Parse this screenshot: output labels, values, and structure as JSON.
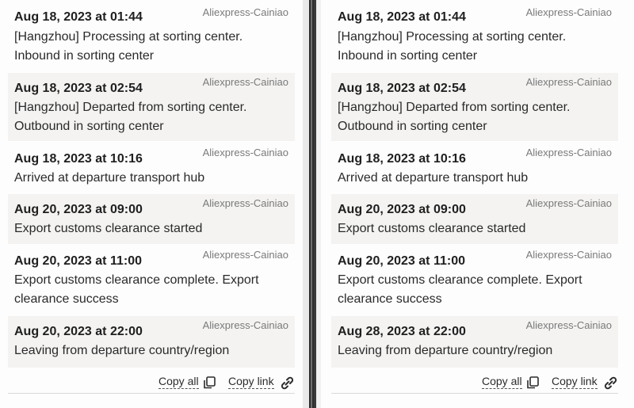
{
  "panels": [
    {
      "events": [
        {
          "date": "Aug 18, 2023 at 01:44",
          "source": "Aliexpress-Cainiao",
          "lines": [
            "[Hangzhou] Processing at sorting center.",
            "Inbound in sorting center"
          ]
        },
        {
          "date": "Aug 18, 2023 at 02:54",
          "source": "Aliexpress-Cainiao",
          "lines": [
            "[Hangzhou] Departed from sorting center.",
            "Outbound in sorting center"
          ]
        },
        {
          "date": "Aug 18, 2023 at 10:16",
          "source": "Aliexpress-Cainiao",
          "lines": [
            "Arrived at departure transport hub"
          ]
        },
        {
          "date": "Aug 20, 2023 at 09:00",
          "source": "Aliexpress-Cainiao",
          "lines": [
            "Export customs clearance started"
          ]
        },
        {
          "date": "Aug 20, 2023 at 11:00",
          "source": "Aliexpress-Cainiao",
          "lines": [
            "Export customs clearance complete. Export",
            "clearance success"
          ]
        },
        {
          "date": "Aug 20, 2023 at 22:00",
          "source": "Aliexpress-Cainiao",
          "lines": [
            "Leaving from departure country/region"
          ]
        }
      ],
      "copy_all": "Copy all",
      "copy_link": "Copy link"
    },
    {
      "events": [
        {
          "date": "Aug 18, 2023 at 01:44",
          "source": "Aliexpress-Cainiao",
          "lines": [
            "[Hangzhou] Processing at sorting center.",
            "Inbound in sorting center"
          ]
        },
        {
          "date": "Aug 18, 2023 at 02:54",
          "source": "Aliexpress-Cainiao",
          "lines": [
            "[Hangzhou] Departed from sorting center.",
            "Outbound in sorting center"
          ]
        },
        {
          "date": "Aug 18, 2023 at 10:16",
          "source": "Aliexpress-Cainiao",
          "lines": [
            "Arrived at departure transport hub"
          ]
        },
        {
          "date": "Aug 20, 2023 at 09:00",
          "source": "Aliexpress-Cainiao",
          "lines": [
            "Export customs clearance started"
          ]
        },
        {
          "date": "Aug 20, 2023 at 11:00",
          "source": "Aliexpress-Cainiao",
          "lines": [
            "Export customs clearance complete. Export",
            "clearance success"
          ]
        },
        {
          "date": "Aug 28, 2023 at 22:00",
          "source": "Aliexpress-Cainiao",
          "lines": [
            "Leaving from departure country/region"
          ]
        }
      ],
      "copy_all": "Copy all",
      "copy_link": "Copy link"
    }
  ],
  "icons": {
    "copy": "copy-icon",
    "link": "link-icon"
  },
  "colors": {
    "card_shade": "#f4f3f2",
    "text": "#1f1f1f",
    "source": "#7a7a7a"
  }
}
